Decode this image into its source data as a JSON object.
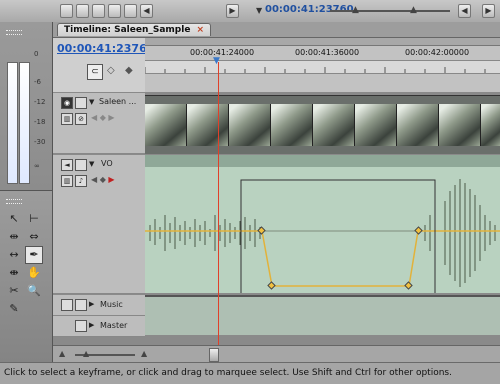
{
  "top_bar": {
    "timecode": "00:00:41:23760"
  },
  "timeline": {
    "tab_title": "Timeline: Saleen_Sample",
    "tab_close": "×",
    "sequence_timecode": "00:00:41:23760",
    "ruler_ticks": [
      "00:00:41:24000",
      "00:00:41:36000",
      "00:00:42:00000"
    ]
  },
  "tracks": {
    "video": {
      "name": "Saleen ..."
    },
    "vo": {
      "name": "VO"
    },
    "music": {
      "name": "Music"
    },
    "master": {
      "name": "Master"
    }
  },
  "meters": {
    "db_labels": [
      "0",
      "-6",
      "-12",
      "-18",
      "-30",
      "∞"
    ]
  },
  "status_bar": {
    "text": "Click to select a keyframe, or click and drag to marquee select. Use Shift and Ctrl for other options."
  },
  "colors": {
    "playhead": "#e0402a",
    "timecode": "#1f56b8",
    "keyframe_line": "#e2b23a"
  },
  "icons": [
    "eye-icon",
    "speaker-icon",
    "selection-tool-icon",
    "pen-tool-icon",
    "hand-tool-icon",
    "zoom-tool-icon",
    "razor-tool-icon"
  ]
}
